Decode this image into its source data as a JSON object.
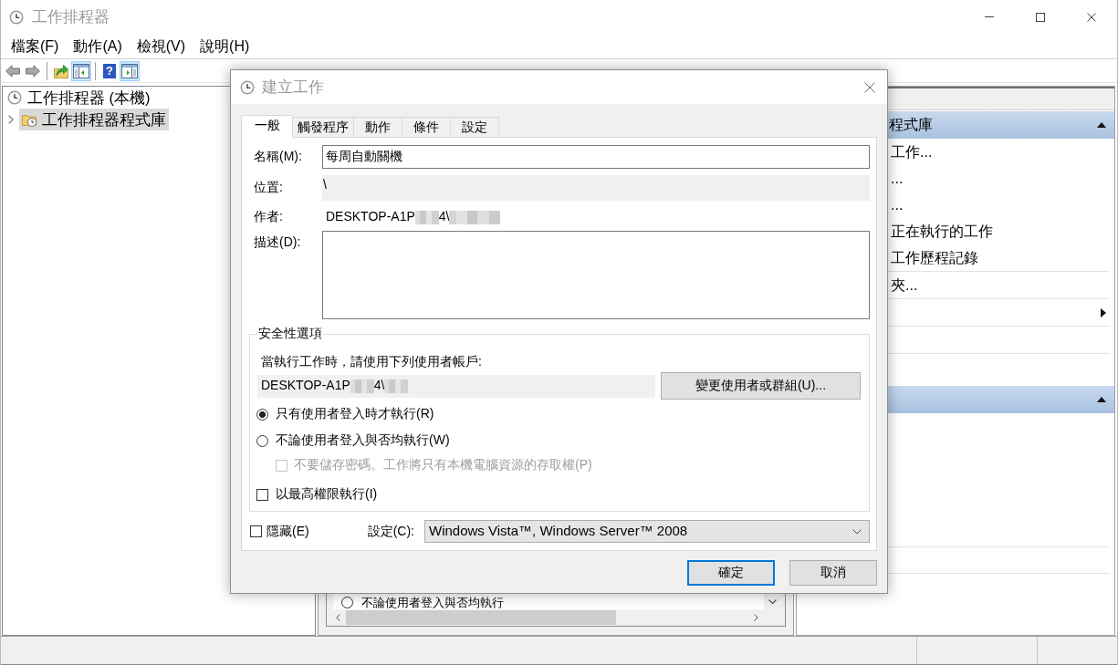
{
  "window": {
    "title": "工作排程器"
  },
  "menu": [
    "檔案(F)",
    "動作(A)",
    "檢視(V)",
    "說明(H)"
  ],
  "toolbar": {
    "buttons": [
      {
        "pressed": false
      },
      {
        "pressed": false
      },
      {
        "pressed": false
      },
      {
        "pressed": true
      },
      {
        "pressed": false,
        "glyph": "?"
      },
      {
        "pressed": true
      }
    ]
  },
  "tree": [
    {
      "label": "工作排程器 (本機)",
      "selected": false,
      "children": [
        {
          "label": "工作排程器程式庫",
          "selected": true,
          "expanded": false
        }
      ]
    }
  ],
  "middle_pane": {
    "rows": [
      {
        "label": "不論使用者登入與否均執行",
        "checked": false
      }
    ]
  },
  "action_pane": {
    "sections": [
      {
        "title": "程式庫",
        "expanded": true,
        "items": [
          {
            "kind": "action",
            "label": "工作..."
          },
          {
            "kind": "action",
            "label": "..."
          },
          {
            "kind": "action",
            "label": "..."
          },
          {
            "kind": "action",
            "label": "正在執行的工作"
          },
          {
            "kind": "action",
            "label": "工作歷程記錄"
          },
          {
            "kind": "separator"
          },
          {
            "kind": "action",
            "label": "夾..."
          },
          {
            "kind": "separator"
          },
          {
            "kind": "submenu"
          },
          {
            "kind": "separator"
          },
          {
            "kind": "action"
          },
          {
            "kind": "separator"
          },
          {
            "kind": "action"
          }
        ]
      },
      {
        "expanded": true
      }
    ]
  },
  "dialog": {
    "title": "建立工作",
    "tabs": [
      {
        "label": "一般",
        "selected": true
      },
      {
        "label": "觸發程序",
        "selected": false
      },
      {
        "label": "動作",
        "selected": false
      },
      {
        "label": "條件",
        "selected": false
      },
      {
        "label": "設定",
        "selected": false
      }
    ],
    "name": {
      "label": "名稱(M):",
      "value": "每周自動關機"
    },
    "location": {
      "label": "位置:",
      "value": "\\"
    },
    "author": {
      "label": "作者:",
      "parts": [
        {
          "kind": "text",
          "text": "DESKTOP-A1P"
        },
        {
          "kind": "redacted"
        },
        {
          "kind": "text",
          "text": "4\\"
        },
        {
          "kind": "redacted"
        }
      ]
    },
    "description": {
      "label": "描述(D):"
    },
    "security": {
      "legend": "安全性選項",
      "prompt": "當執行工作時，請使用下列使用者帳戶:",
      "account": [
        {
          "kind": "text",
          "text": "DESKTOP-A1P"
        },
        {
          "kind": "redacted"
        },
        {
          "kind": "text",
          "text": "4\\"
        },
        {
          "kind": "redacted"
        }
      ],
      "change_button": "變更使用者或群組(U)...",
      "options": [
        {
          "kind": "radio",
          "label": "只有使用者登入時才執行(R)",
          "checked": true,
          "disabled": false
        },
        {
          "kind": "radio",
          "label": "不論使用者登入與否均執行(W)",
          "checked": false,
          "disabled": false,
          "children": [
            {
              "kind": "checkbox",
              "label": "不要儲存密碼。工作將只有本機電腦資源的存取權(P)",
              "checked": false,
              "disabled": true
            }
          ]
        },
        {
          "kind": "checkbox",
          "label": "以最高權限執行(I)",
          "checked": false,
          "disabled": false
        }
      ]
    },
    "hidden": {
      "label": "隱藏(E)",
      "checked": false
    },
    "configure": {
      "label": "設定(C):",
      "value": "Windows Vista™, Windows Server™ 2008"
    },
    "buttons": [
      {
        "label": "確定",
        "default": true
      },
      {
        "label": "取消",
        "default": false
      }
    ]
  }
}
